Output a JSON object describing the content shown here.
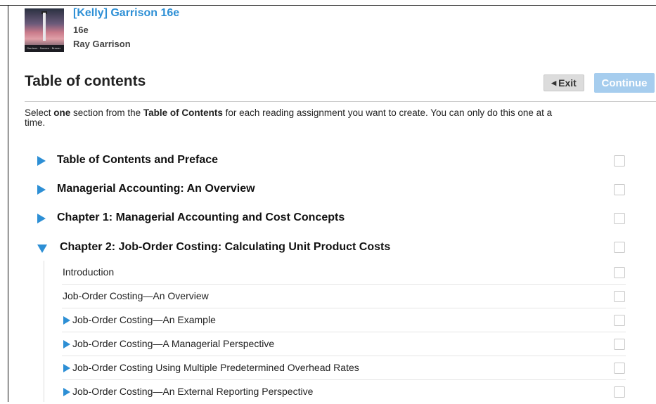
{
  "book": {
    "title": "[Kelly] Garrison 16e",
    "edition": "16e",
    "author": "Ray Garrison",
    "cover_authors": "Garrison · Noreen · Brewer"
  },
  "header": {
    "title": "Table of contents",
    "exit_label": "Exit",
    "exit_icon": "◀",
    "continue_label": "Continue"
  },
  "instructions": {
    "pre": "Select ",
    "bold1": "one",
    "mid": " section from the ",
    "bold2": "Table of Contents",
    "post": " for each reading assignment you want to create. You can only do this one at a time."
  },
  "sections": [
    {
      "label": "Table of Contents and Preface",
      "expanded": false,
      "checked": false
    },
    {
      "label": "Managerial Accounting: An Overview",
      "expanded": false,
      "checked": false
    },
    {
      "label": "Chapter 1: Managerial Accounting and Cost Concepts",
      "expanded": false,
      "checked": false
    },
    {
      "label": "Chapter 2: Job-Order Costing: Calculating Unit Product Costs",
      "expanded": true,
      "checked": false
    }
  ],
  "subsections": [
    {
      "label": "Introduction",
      "has_children": false,
      "checked": false
    },
    {
      "label": "Job-Order Costing—An Overview",
      "has_children": false,
      "checked": false
    },
    {
      "label": "Job-Order Costing—An Example",
      "has_children": true,
      "checked": false
    },
    {
      "label": "Job-Order Costing—A Managerial Perspective",
      "has_children": true,
      "checked": false
    },
    {
      "label": "Job-Order Costing Using Multiple Predetermined Overhead Rates",
      "has_children": true,
      "checked": false
    },
    {
      "label": "Job-Order Costing—An External Reporting Perspective",
      "has_children": true,
      "checked": false
    }
  ],
  "colors": {
    "link_blue": "#2d8fd5",
    "continue_disabled": "#a6cdee",
    "exit_bg": "#dcdcdc"
  }
}
